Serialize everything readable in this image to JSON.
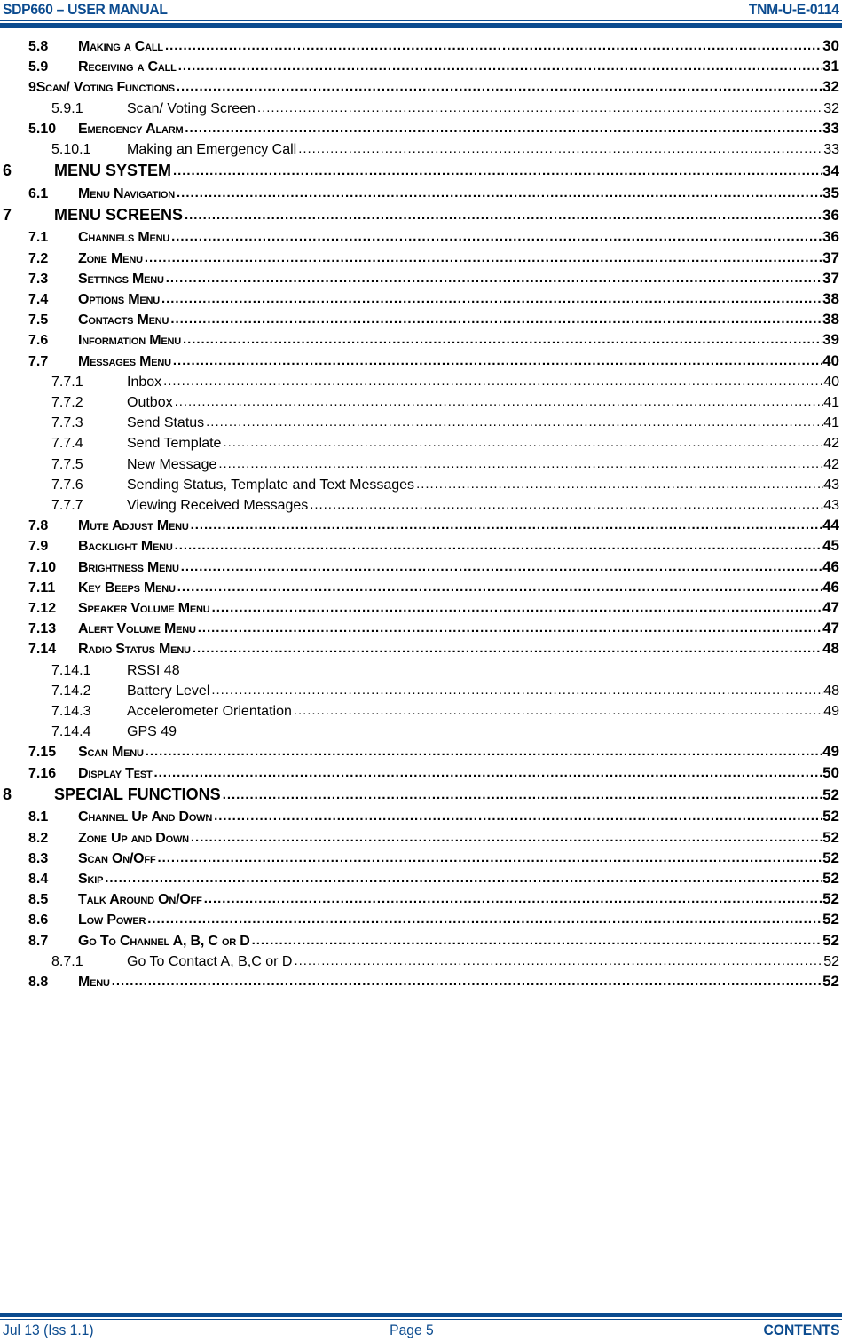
{
  "header": {
    "title": "SDP660 – USER MANUAL",
    "doc_number": "TNM-U-E-0114"
  },
  "footer": {
    "date_issue": "Jul 13 (Iss 1.1)",
    "page": "Page 5",
    "section": "CONTENTS"
  },
  "colors": {
    "brand_blue": "#0b4b8f"
  },
  "toc": [
    {
      "level": 2,
      "num": "5.8",
      "title": "Making a Call",
      "page": "30"
    },
    {
      "level": 2,
      "num": "5.9",
      "title": "Receiving a Call",
      "page": "31"
    },
    {
      "level": 2,
      "num": "",
      "title": "9Scan/ Voting Functions",
      "page": "32"
    },
    {
      "level": 3,
      "num": "5.9.1",
      "title": "Scan/ Voting Screen",
      "page": "32"
    },
    {
      "level": 2,
      "num": "5.10",
      "title": "Emergency Alarm",
      "page": "33"
    },
    {
      "level": 3,
      "num": "5.10.1",
      "title": "Making an Emergency Call",
      "page": "33"
    },
    {
      "level": 1,
      "num": "6",
      "title": "MENU SYSTEM",
      "page": "34"
    },
    {
      "level": 2,
      "num": "6.1",
      "title": "Menu Navigation",
      "page": "35"
    },
    {
      "level": 1,
      "num": "7",
      "title": "MENU SCREENS",
      "page": "36"
    },
    {
      "level": 2,
      "num": "7.1",
      "title": "Channels Menu",
      "page": "36"
    },
    {
      "level": 2,
      "num": "7.2",
      "title": "Zone Menu",
      "page": "37"
    },
    {
      "level": 2,
      "num": "7.3",
      "title": "Settings Menu",
      "page": "37"
    },
    {
      "level": 2,
      "num": "7.4",
      "title": "Options Menu",
      "page": "38"
    },
    {
      "level": 2,
      "num": "7.5",
      "title": "Contacts Menu",
      "page": "38"
    },
    {
      "level": 2,
      "num": "7.6",
      "title": "Information Menu",
      "page": "39"
    },
    {
      "level": 2,
      "num": "7.7",
      "title": "Messages Menu",
      "page": "40"
    },
    {
      "level": 3,
      "num": "7.7.1",
      "title": "Inbox",
      "page": "40"
    },
    {
      "level": 3,
      "num": "7.7.2",
      "title": "Outbox",
      "page": "41"
    },
    {
      "level": 3,
      "num": "7.7.3",
      "title": "Send Status",
      "page": "41"
    },
    {
      "level": 3,
      "num": "7.7.4",
      "title": "Send Template",
      "page": "42"
    },
    {
      "level": 3,
      "num": "7.7.5",
      "title": "New Message",
      "page": "42"
    },
    {
      "level": 3,
      "num": "7.7.6",
      "title": "Sending Status, Template and Text Messages",
      "page": "43"
    },
    {
      "level": 3,
      "num": "7.7.7",
      "title": "Viewing Received Messages",
      "page": "43"
    },
    {
      "level": 2,
      "num": "7.8",
      "title": "Mute Adjust Menu",
      "page": "44"
    },
    {
      "level": 2,
      "num": "7.9",
      "title": "Backlight Menu",
      "page": "45"
    },
    {
      "level": 2,
      "num": "7.10",
      "title": "Brightness Menu",
      "page": "46"
    },
    {
      "level": 2,
      "num": "7.11",
      "title": "Key Beeps Menu",
      "page": "46"
    },
    {
      "level": 2,
      "num": "7.12",
      "title": "Speaker Volume Menu",
      "page": "47"
    },
    {
      "level": 2,
      "num": "7.13",
      "title": "Alert Volume Menu",
      "page": "47"
    },
    {
      "level": 2,
      "num": "7.14",
      "title": "Radio Status Menu",
      "page": "48"
    },
    {
      "level": 3,
      "num": "7.14.1",
      "title": "RSSI 48",
      "page": "",
      "noleader": true
    },
    {
      "level": 3,
      "num": "7.14.2",
      "title": "Battery Level",
      "page": "48"
    },
    {
      "level": 3,
      "num": "7.14.3",
      "title": "Accelerometer Orientation",
      "page": "49"
    },
    {
      "level": 3,
      "num": "7.14.4",
      "title": "GPS  49",
      "page": "",
      "noleader": true
    },
    {
      "level": 2,
      "num": "7.15",
      "title": "Scan Menu",
      "page": "49"
    },
    {
      "level": 2,
      "num": "7.16",
      "title": "Display Test",
      "page": "50"
    },
    {
      "level": 1,
      "num": "8",
      "title": "SPECIAL FUNCTIONS",
      "page": "52"
    },
    {
      "level": 2,
      "num": "8.1",
      "title": "Channel Up And Down",
      "page": "52"
    },
    {
      "level": 2,
      "num": "8.2",
      "title": "Zone Up and Down",
      "page": "52"
    },
    {
      "level": 2,
      "num": "8.3",
      "title": "Scan On/Off",
      "page": "52"
    },
    {
      "level": 2,
      "num": "8.4",
      "title": "Skip",
      "page": "52"
    },
    {
      "level": 2,
      "num": "8.5",
      "title": "Talk Around On/Off",
      "page": "52"
    },
    {
      "level": 2,
      "num": "8.6",
      "title": "Low Power",
      "page": "52"
    },
    {
      "level": 2,
      "num": "8.7",
      "title": "Go To Channel  A, B, C or D",
      "page": "52"
    },
    {
      "level": 3,
      "num": "8.7.1",
      "title": "Go To Contact A, B,C or D",
      "page": "52"
    },
    {
      "level": 2,
      "num": "8.8",
      "title": "Menu",
      "page": "52"
    }
  ]
}
